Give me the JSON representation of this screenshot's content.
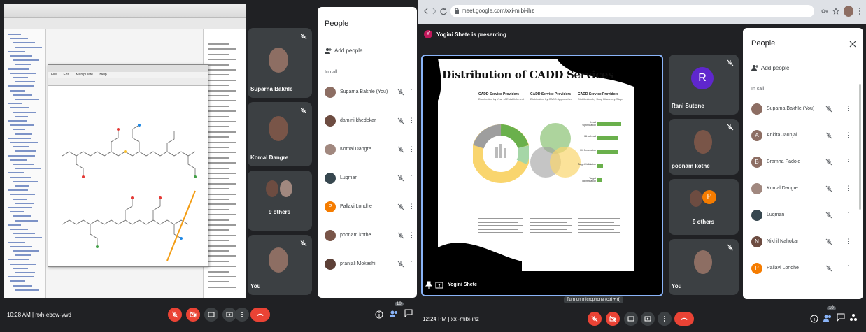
{
  "left": {
    "presenter_tiles": [
      {
        "name": "Suparna Bakhle"
      },
      {
        "name": "Komal Dangre"
      },
      {
        "name": "9 others"
      },
      {
        "name": "You"
      }
    ],
    "people": {
      "title": "People",
      "add_people": "Add people",
      "in_call": "In call",
      "participants": [
        {
          "name": "Suparna Bakhle (You)",
          "avatar_color": "#8d6e63"
        },
        {
          "name": "damini khedekar",
          "avatar_color": "#6d4c41"
        },
        {
          "name": "Komal Dangre",
          "avatar_color": "#a1887f"
        },
        {
          "name": "Luqman",
          "avatar_color": "#37474f"
        },
        {
          "name": "Pallavi Londhe",
          "avatar_color": "#f57c00",
          "initial": "P"
        },
        {
          "name": "poonam kothe",
          "avatar_color": "#795548"
        },
        {
          "name": "pranjali Mokashi",
          "avatar_color": "#5d4037"
        }
      ]
    },
    "bottom": {
      "time": "10:28 AM",
      "separator": "|",
      "meeting_code": "nxh-ebow-ywd",
      "badge_count": "10"
    },
    "shared_screen": {
      "menu_items": [
        "File",
        "Edit",
        "Manipulate",
        "Help"
      ]
    }
  },
  "right": {
    "browser": {
      "url": "meet.google.com/xxi-mibi-ihz"
    },
    "presenting_banner": "Yogini Shete is presenting",
    "presenter_initial": "Y",
    "presenter_label": "Yogini Shete",
    "slide": {
      "title": "Distribution of CADD Services",
      "columns": [
        {
          "head": "CADD Service Providers",
          "sub": "Distribution by Year of Establishment"
        },
        {
          "head": "CADD Service Providers",
          "sub": "Distribution by CADD Approaches"
        },
        {
          "head": "CADD Service Providers",
          "sub": "Distribution by Drug Discovery Steps"
        }
      ],
      "bar_labels": [
        "Lead Optimization",
        "Hit to Lead",
        "Hit Generation",
        "Target Validation",
        "Target Identification"
      ]
    },
    "tiles": [
      {
        "name": "Rani Sutone",
        "initial": "R",
        "color": "#5f27cd"
      },
      {
        "name": "poonam kothe"
      },
      {
        "name": "9 others",
        "initial": "P",
        "color": "#f57c00"
      },
      {
        "name": "You"
      }
    ],
    "people": {
      "title": "People",
      "add_people": "Add people",
      "in_call": "In call",
      "participants": [
        {
          "name": "Suparna Bakhle (You)",
          "avatar_color": "#8d6e63"
        },
        {
          "name": "Ankita Jaunjal",
          "avatar_color": "#8d6e63",
          "initial": "A"
        },
        {
          "name": "Bramha Padole",
          "avatar_color": "#8d6e63",
          "initial": "B"
        },
        {
          "name": "Komal Dangre",
          "avatar_color": "#a1887f"
        },
        {
          "name": "Luqman",
          "avatar_color": "#37474f"
        },
        {
          "name": "Nikhil Nahokar",
          "avatar_color": "#6d4c41",
          "initial": "N"
        },
        {
          "name": "Pallavi Londhe",
          "avatar_color": "#f57c00",
          "initial": "P"
        }
      ]
    },
    "tooltip": "Turn on microphone (ctrl + d)",
    "bottom": {
      "time": "12:24 PM",
      "separator": "|",
      "meeting_code": "xxi-mibi-ihz",
      "badge_count": "10"
    }
  },
  "colors": {
    "meet_dark": "#202124",
    "tile": "#3c4043",
    "red": "#ea4335",
    "presenting_border": "#8ab4f8",
    "chart_green": "#6ab04c",
    "chart_yellow": "#f9d56e",
    "chart_grey": "#9e9e9e"
  }
}
